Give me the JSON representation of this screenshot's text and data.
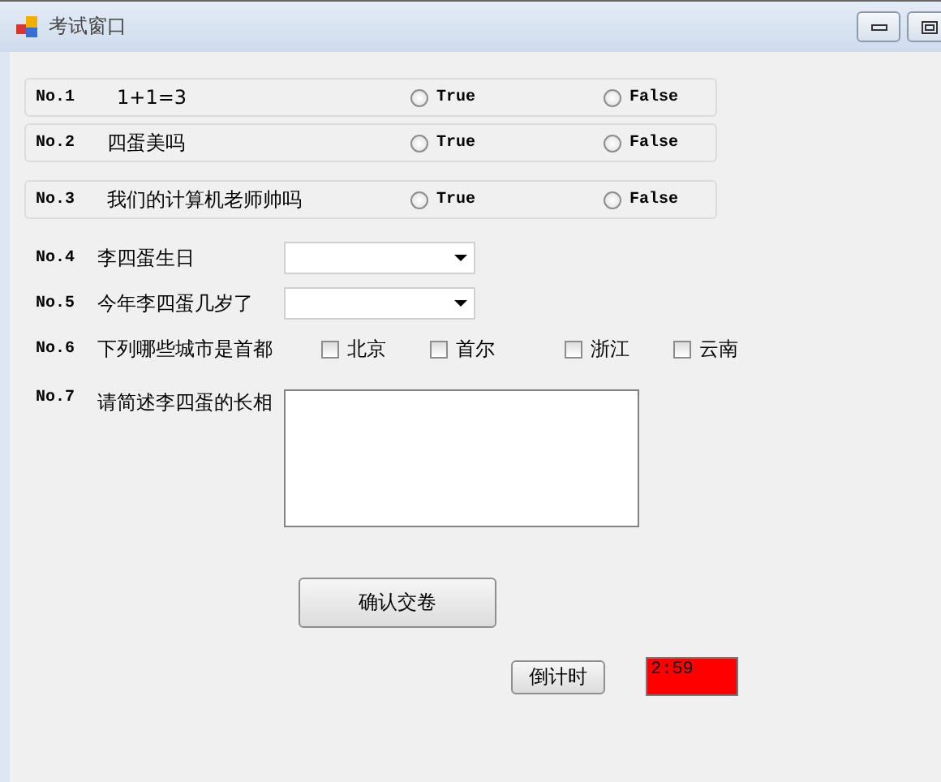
{
  "window": {
    "title": "考试窗口"
  },
  "radio_questions": [
    {
      "number": "No.1",
      "text": "1+1=3",
      "options": [
        {
          "label": "True",
          "selected": false
        },
        {
          "label": "False",
          "selected": false
        }
      ]
    },
    {
      "number": "No.2",
      "text": "四蛋美吗",
      "options": [
        {
          "label": "True",
          "selected": false
        },
        {
          "label": "False",
          "selected": false
        }
      ]
    },
    {
      "number": "No.3",
      "text": "我们的计算机老师帅吗",
      "options": [
        {
          "label": "True",
          "selected": false
        },
        {
          "label": "False",
          "selected": false
        }
      ]
    }
  ],
  "dropdown_questions": [
    {
      "number": "No.4",
      "text": "李四蛋生日"
    },
    {
      "number": "No.5",
      "text": "今年李四蛋几岁了"
    }
  ],
  "checkbox_question": {
    "number": "No.6",
    "text": "下列哪些城市是首都",
    "options": [
      {
        "label": "北京",
        "checked": false
      },
      {
        "label": "首尔",
        "checked": false
      },
      {
        "label": "浙江",
        "checked": false
      },
      {
        "label": "云南",
        "checked": false
      }
    ]
  },
  "text_question": {
    "number": "No.7",
    "text": "请简述李四蛋的长相"
  },
  "submit_button": "确认交卷",
  "countdown_button": "倒计时",
  "timer": {
    "value": "2:59",
    "color": "#ff0000"
  }
}
